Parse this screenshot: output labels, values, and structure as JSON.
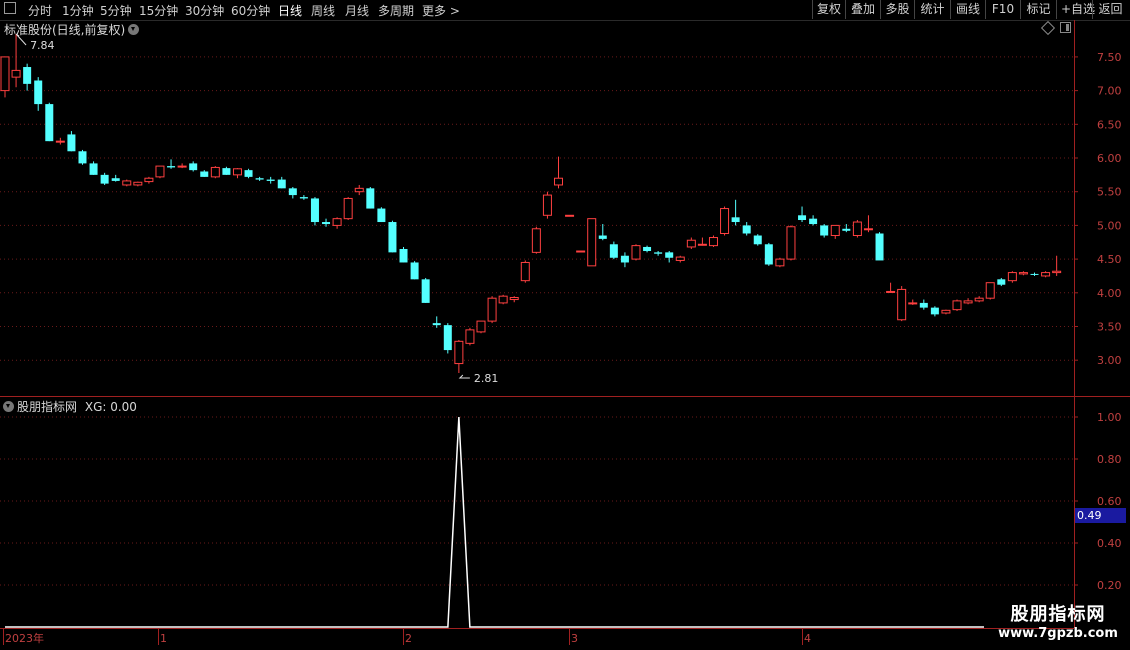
{
  "toolbar": {
    "periods": [
      "分时",
      "1分钟",
      "5分钟",
      "15分钟",
      "30分钟",
      "60分钟",
      "日线",
      "周线",
      "月线",
      "多周期",
      "更多 >"
    ],
    "active_period": "日线",
    "buttons": [
      "复权",
      "叠加",
      "多股",
      "统计",
      "画线",
      "F10",
      "标记",
      "+自选",
      "返回"
    ]
  },
  "main_panel": {
    "title": "标准股份(日线,前复权)",
    "high_label": "7.84",
    "low_label": "2.81",
    "y_ticks": [
      "7.50",
      "7.00",
      "6.50",
      "6.00",
      "5.50",
      "5.00",
      "4.50",
      "4.00",
      "3.50",
      "3.00"
    ],
    "up_color": "#ff4040",
    "down_color": "#54ffff"
  },
  "indicator_panel": {
    "title": "股朋指标网",
    "value_label": "XG: 0.00",
    "y_ticks": [
      "1.00",
      "0.80",
      "0.60",
      "0.40",
      "0.20"
    ],
    "current_value": "0.49"
  },
  "time_axis": {
    "labels": [
      "2023年",
      "1",
      "2",
      "3",
      "4"
    ]
  },
  "watermark": {
    "line1": "股朋指标网",
    "line2": "www.7gpzb.com"
  },
  "chart_data": [
    {
      "type": "candlestick",
      "title": "标准股份(日线,前复权)",
      "ylim": [
        2.7,
        7.95
      ],
      "candles": [
        [
          7.0,
          7.5,
          6.9,
          7.5
        ],
        [
          7.2,
          7.84,
          7.05,
          7.3
        ],
        [
          7.35,
          7.4,
          7.0,
          7.1
        ],
        [
          7.15,
          7.2,
          6.7,
          6.8
        ],
        [
          6.8,
          6.82,
          6.25,
          6.25
        ],
        [
          6.25,
          6.3,
          6.2,
          6.25
        ],
        [
          6.35,
          6.4,
          6.1,
          6.1
        ],
        [
          6.1,
          6.12,
          5.9,
          5.92
        ],
        [
          5.92,
          5.95,
          5.75,
          5.75
        ],
        [
          5.75,
          5.78,
          5.6,
          5.62
        ],
        [
          5.7,
          5.75,
          5.65,
          5.66
        ],
        [
          5.6,
          5.68,
          5.58,
          5.66
        ],
        [
          5.6,
          5.65,
          5.58,
          5.64
        ],
        [
          5.65,
          5.72,
          5.62,
          5.7
        ],
        [
          5.72,
          5.88,
          5.7,
          5.88
        ],
        [
          5.88,
          5.98,
          5.84,
          5.86
        ],
        [
          5.88,
          5.92,
          5.85,
          5.88
        ],
        [
          5.92,
          5.95,
          5.8,
          5.82
        ],
        [
          5.8,
          5.82,
          5.72,
          5.72
        ],
        [
          5.72,
          5.88,
          5.7,
          5.86
        ],
        [
          5.85,
          5.87,
          5.75,
          5.75
        ],
        [
          5.75,
          5.85,
          5.7,
          5.84
        ],
        [
          5.82,
          5.84,
          5.7,
          5.72
        ],
        [
          5.7,
          5.72,
          5.66,
          5.68
        ],
        [
          5.68,
          5.72,
          5.62,
          5.66
        ],
        [
          5.68,
          5.72,
          5.55,
          5.55
        ],
        [
          5.55,
          5.57,
          5.4,
          5.45
        ],
        [
          5.42,
          5.45,
          5.38,
          5.4
        ],
        [
          5.4,
          5.42,
          5.0,
          5.05
        ],
        [
          5.05,
          5.1,
          4.98,
          5.02
        ],
        [
          5.0,
          5.12,
          4.95,
          5.1
        ],
        [
          5.1,
          5.42,
          5.08,
          5.4
        ],
        [
          5.5,
          5.6,
          5.45,
          5.55
        ],
        [
          5.55,
          5.57,
          5.25,
          5.25
        ],
        [
          5.25,
          5.27,
          5.05,
          5.05
        ],
        [
          5.05,
          5.07,
          4.6,
          4.6
        ],
        [
          4.65,
          4.68,
          4.45,
          4.45
        ],
        [
          4.45,
          4.47,
          4.2,
          4.2
        ],
        [
          4.2,
          4.22,
          3.85,
          3.85
        ],
        [
          3.55,
          3.65,
          3.48,
          3.52
        ],
        [
          3.52,
          3.55,
          3.1,
          3.15
        ],
        [
          2.95,
          3.3,
          2.81,
          3.28
        ],
        [
          3.25,
          3.48,
          3.22,
          3.45
        ],
        [
          3.42,
          3.58,
          3.4,
          3.58
        ],
        [
          3.58,
          3.95,
          3.55,
          3.92
        ],
        [
          3.85,
          3.97,
          3.83,
          3.95
        ],
        [
          3.9,
          3.95,
          3.86,
          3.93
        ],
        [
          4.18,
          4.48,
          4.15,
          4.45
        ],
        [
          4.6,
          4.98,
          4.58,
          4.95
        ],
        [
          5.15,
          5.5,
          5.1,
          5.45
        ],
        [
          5.6,
          6.02,
          5.55,
          5.7
        ],
        [
          5.15,
          5.15,
          5.15,
          5.15
        ],
        [
          4.62,
          4.62,
          4.62,
          4.62
        ],
        [
          4.4,
          5.1,
          4.4,
          5.1
        ],
        [
          4.85,
          5.02,
          4.78,
          4.8
        ],
        [
          4.72,
          4.76,
          4.5,
          4.52
        ],
        [
          4.55,
          4.6,
          4.38,
          4.45
        ],
        [
          4.5,
          4.72,
          4.48,
          4.7
        ],
        [
          4.68,
          4.7,
          4.6,
          4.62
        ],
        [
          4.6,
          4.62,
          4.55,
          4.58
        ],
        [
          4.6,
          4.62,
          4.45,
          4.52
        ],
        [
          4.48,
          4.55,
          4.45,
          4.53
        ],
        [
          4.68,
          4.82,
          4.65,
          4.78
        ],
        [
          4.72,
          4.82,
          4.7,
          4.72
        ],
        [
          4.7,
          4.85,
          4.68,
          4.82
        ],
        [
          4.88,
          5.28,
          4.85,
          5.25
        ],
        [
          5.12,
          5.38,
          5.0,
          5.05
        ],
        [
          5.0,
          5.05,
          4.85,
          4.88
        ],
        [
          4.85,
          4.87,
          4.7,
          4.72
        ],
        [
          4.72,
          4.74,
          4.4,
          4.42
        ],
        [
          4.4,
          4.52,
          4.38,
          4.5
        ],
        [
          4.5,
          5.0,
          4.48,
          4.98
        ],
        [
          5.15,
          5.28,
          5.05,
          5.08
        ],
        [
          5.1,
          5.15,
          5.0,
          5.02
        ],
        [
          5.0,
          5.02,
          4.82,
          4.85
        ],
        [
          4.85,
          5.0,
          4.8,
          5.0
        ],
        [
          4.95,
          5.02,
          4.9,
          4.92
        ],
        [
          4.85,
          5.08,
          4.82,
          5.05
        ],
        [
          4.95,
          5.15,
          4.9,
          4.95
        ],
        [
          4.88,
          4.9,
          4.5,
          4.48
        ],
        [
          4.02,
          4.15,
          4.0,
          4.02
        ],
        [
          3.6,
          4.1,
          3.58,
          4.05
        ],
        [
          3.85,
          3.9,
          3.82,
          3.85
        ],
        [
          3.85,
          3.9,
          3.75,
          3.78
        ],
        [
          3.78,
          3.8,
          3.65,
          3.68
        ],
        [
          3.7,
          3.75,
          3.68,
          3.74
        ],
        [
          3.75,
          3.9,
          3.73,
          3.88
        ],
        [
          3.85,
          3.92,
          3.83,
          3.88
        ],
        [
          3.88,
          3.95,
          3.86,
          3.92
        ],
        [
          3.92,
          4.15,
          3.9,
          4.15
        ],
        [
          4.2,
          4.22,
          4.1,
          4.12
        ],
        [
          4.18,
          4.32,
          4.15,
          4.3
        ],
        [
          4.28,
          4.32,
          4.26,
          4.3
        ],
        [
          4.28,
          4.3,
          4.25,
          4.27
        ],
        [
          4.25,
          4.32,
          4.23,
          4.3
        ],
        [
          4.3,
          4.55,
          4.25,
          4.32
        ]
      ]
    },
    {
      "type": "line",
      "title": "股朋指标网",
      "series": [
        {
          "name": "XG",
          "spike_index": 41,
          "baseline": 0,
          "peak": 1.0
        }
      ],
      "ylim": [
        0,
        1.05
      ]
    }
  ]
}
